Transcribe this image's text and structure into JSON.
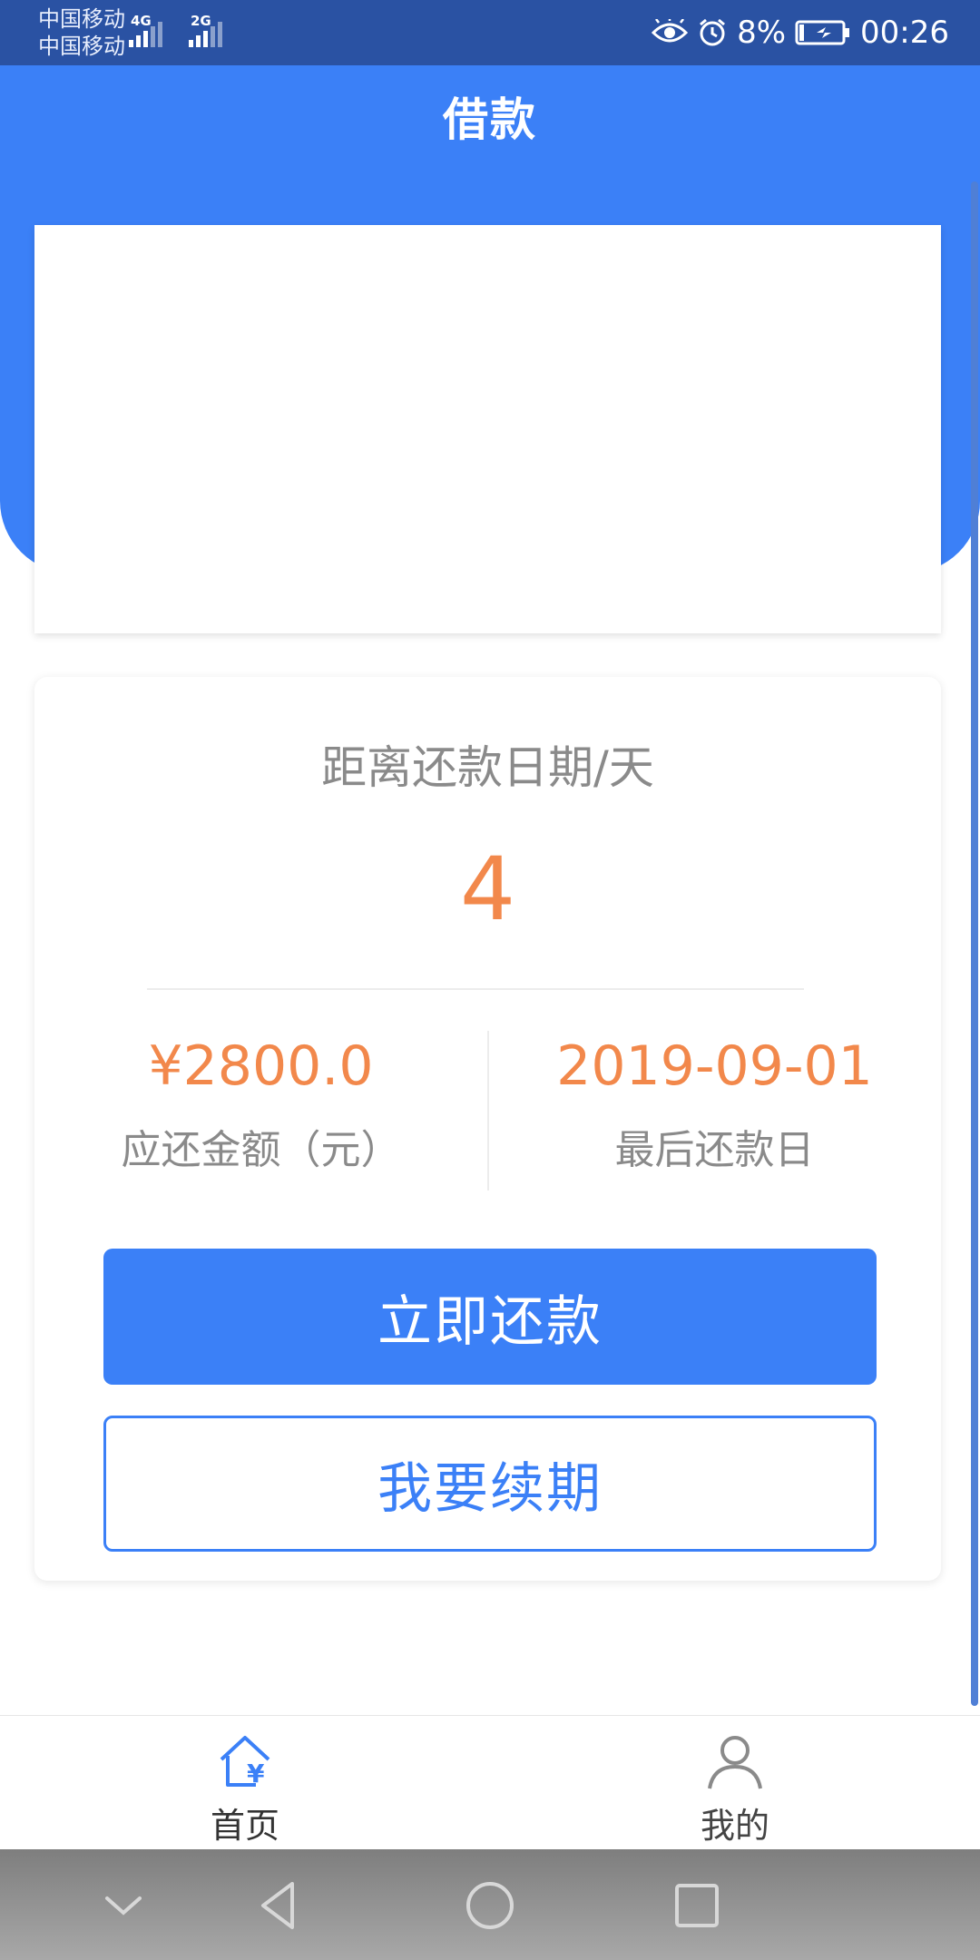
{
  "status_bar": {
    "carrier_1": "中国移动",
    "carrier_2": "中国移动",
    "network_1": "4G",
    "network_2": "2G",
    "battery": "8%",
    "time": "00:26",
    "icons": [
      "eye-comfort-icon",
      "alarm-icon",
      "battery-charging-icon"
    ]
  },
  "header": {
    "title": "借款"
  },
  "repayment": {
    "days_label": "距离还款日期/天",
    "days_value": "4",
    "amount_value": "¥2800.0",
    "amount_label": "应还金额（元）",
    "due_date_value": "2019-09-01",
    "due_date_label": "最后还款日",
    "repay_button": "立即还款",
    "renew_button": "我要续期"
  },
  "tab_bar": {
    "items": [
      {
        "label": "首页",
        "icon": "home-yuan-icon",
        "active": true
      },
      {
        "label": "我的",
        "icon": "person-icon",
        "active": false
      }
    ]
  },
  "colors": {
    "accent": "#3b80f7",
    "status_bar": "#2a52a3",
    "highlight_orange": "#f2884b",
    "muted_text": "#8a8a8a"
  }
}
